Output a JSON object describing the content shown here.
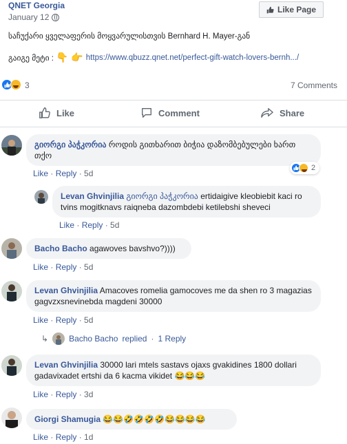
{
  "post": {
    "page_name": "QNET Georgia",
    "date": "January 12",
    "like_page_label": "Like Page",
    "text": "საჩუქარი ყველაფერის მოყვარულისთვის Bernhard H. Mayer-გან",
    "link_prefix": "გაიგე მეტი :",
    "link": "https://www.qbuzz.qnet.net/perfect-gift-watch-lovers-bernh.../",
    "reaction_count": "3",
    "comments_count": "7 Comments"
  },
  "actions": {
    "like": "Like",
    "comment": "Comment",
    "share": "Share"
  },
  "comment_actions": {
    "like": "Like",
    "reply": "Reply"
  },
  "comments": [
    {
      "author": "გიორგი პაჭკორია",
      "text": "როდის გითხარით ბიჭია დაზომბებულები ხართ თქო",
      "time": "5d",
      "reactions_count": "2"
    },
    {
      "author": "Levan Ghvinjilia",
      "mention": "გიორგი პაჭკორია",
      "text": "ertidaigive kleobiebit kaci ro tvins mogitknavs raiqneba dazombdebi ketilebshi sheveci",
      "time": "5d"
    },
    {
      "author": "Bacho Bacho",
      "text": "agawoves bavshvo?))))",
      "time": "5d"
    },
    {
      "author": "Levan Ghvinjilia",
      "text": "Amacoves romelia gamocoves me da shen ro 3 magazias gagvzxsnevinebda magdeni 30000",
      "time": "5d"
    },
    {
      "author": "Levan Ghvinjilia",
      "text": "30000 lari mtels sastavs ojaxs gvakidines 1800 dollari gadavixadet ertshi da 6 kacma vikidet 😂😂😂",
      "time": "3d"
    },
    {
      "author": "Giorgi Shamugia",
      "text": "😂😂🤣🤣🤣🤣😂😂😂😂",
      "time": "1d"
    }
  ],
  "replies_link": {
    "name": "Bacho Bacho",
    "replied": "replied",
    "separator": "·",
    "count": "1 Reply"
  },
  "colors": {
    "link": "#385898",
    "meta": "#606770",
    "bubble": "#f2f3f5",
    "like_blue": "#1877f2",
    "haha_yellow": "#f7b928"
  }
}
